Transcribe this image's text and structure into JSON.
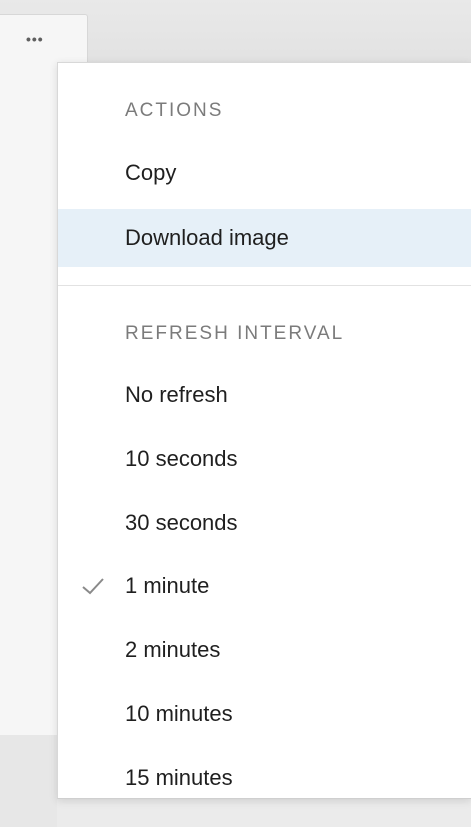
{
  "toolbar": {
    "more_icon": "more-horizontal-icon",
    "more_label": "•••"
  },
  "menu": {
    "actions": {
      "header": "ACTIONS",
      "items": [
        {
          "label": "Copy",
          "active": false
        },
        {
          "label": "Download image",
          "active": true
        }
      ]
    },
    "refresh": {
      "header": "REFRESH INTERVAL",
      "selected_icon": "checkmark-icon",
      "items": [
        {
          "label": "No refresh",
          "selected": false
        },
        {
          "label": "10 seconds",
          "selected": false
        },
        {
          "label": "30 seconds",
          "selected": false
        },
        {
          "label": "1 minute",
          "selected": true
        },
        {
          "label": "2 minutes",
          "selected": false
        },
        {
          "label": "10 minutes",
          "selected": false
        },
        {
          "label": "15 minutes",
          "selected": false
        }
      ]
    }
  },
  "colors": {
    "hover_bg": "#e6f0f8",
    "text": "#1f1f1f",
    "header_text": "#7b7b7b",
    "check": "#8a8a8a"
  }
}
